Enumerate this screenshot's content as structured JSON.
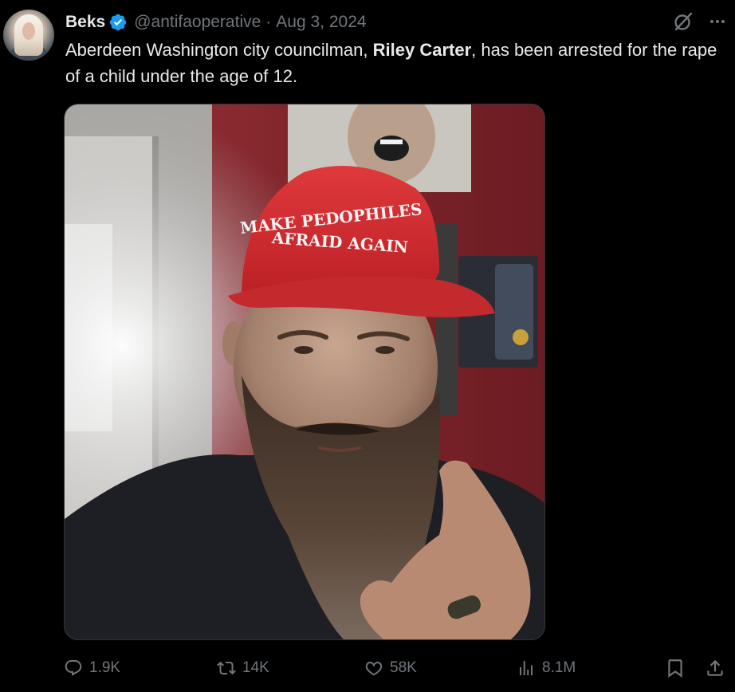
{
  "tweet": {
    "author_name": "Beks",
    "handle": "@antifaoperative",
    "separator": "·",
    "date": "Aug 3, 2024",
    "text_part1": "Aberdeen Washington city councilman, ",
    "text_bold": "Riley Carter",
    "text_part2": ", has been arrested for the rape of a child under the age of 12.",
    "media": {
      "hat_text_line1": "MAKE PEDOPHILES",
      "hat_text_line2": "AFRAID AGAIN"
    },
    "stats": {
      "replies": "1.9K",
      "reposts": "14K",
      "likes": "58K",
      "views": "8.1M"
    }
  },
  "colors": {
    "background": "#000000",
    "text_primary": "#e7e9ea",
    "text_secondary": "#71767b",
    "verified_badge": "#1d9bf0",
    "hat_red": "#d32a2e"
  },
  "icons": {
    "verified": "verified-badge-icon",
    "grok": "grok-icon",
    "more": "more-icon",
    "reply": "reply-icon",
    "retweet": "retweet-icon",
    "like": "heart-icon",
    "views": "views-chart-icon",
    "bookmark": "bookmark-icon",
    "share": "share-icon"
  }
}
